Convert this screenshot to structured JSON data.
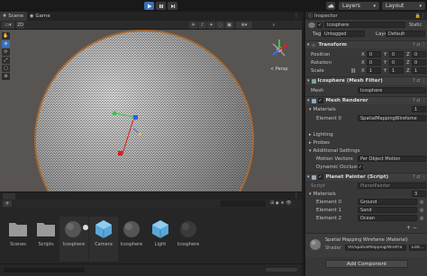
{
  "toolbar": {
    "play_icon": "play-icon",
    "pause_icon": "pause-icon",
    "step_icon": "step-icon",
    "layers_label": "Layers",
    "layout_label": "Layout"
  },
  "tabs": {
    "scene": "Scene",
    "game": "Game"
  },
  "gizmo": {
    "persp_label": "< Persp"
  },
  "project": {
    "assets": [
      {
        "label": "Scenes",
        "icon": "folder-icon"
      },
      {
        "label": "Scripts",
        "icon": "folder-icon"
      },
      {
        "label": "Icosphere",
        "icon": "sphere-icon"
      },
      {
        "label": "Camera",
        "icon": "prefab-cube-icon"
      },
      {
        "label": "Icosphere",
        "icon": "sphere-icon"
      },
      {
        "label": "Light",
        "icon": "prefab-cube-icon"
      },
      {
        "label": "Icosphere",
        "icon": "sphere-icon"
      }
    ]
  },
  "inspector": {
    "tab_label": "Inspector",
    "object_name": "Icosphere",
    "static_label": "Static",
    "tag_label": "Tag",
    "tag_value": "Untagged",
    "layer_label": "Layer",
    "layer_value": "Default",
    "transform": {
      "title": "Transform",
      "position_label": "Position",
      "rotation_label": "Rotation",
      "scale_label": "Scale",
      "position": {
        "x": "0",
        "y": "0",
        "z": "0"
      },
      "rotation": {
        "x": "0",
        "y": "0",
        "z": "0"
      },
      "scale": {
        "x": "1",
        "y": "1",
        "z": "1"
      }
    },
    "mesh_filter": {
      "title": "Icosphere (Mesh Filter)",
      "mesh_label": "Mesh",
      "mesh_value": "Icosphere"
    },
    "mesh_renderer": {
      "title": "Mesh Renderer",
      "materials_label": "Materials",
      "materials_count": "1",
      "element0_label": "Element 0",
      "element0_value": "SpatialMappingWirefame",
      "lighting_label": "Lighting",
      "probes_label": "Probes",
      "additional_label": "Additional Settings",
      "motion_label": "Motion Vectors",
      "motion_value": "Per Object Motion",
      "occlusion_label": "Dynamic Occlusion"
    },
    "planet_painter": {
      "title": "Planet Painter (Script)",
      "script_label": "Script",
      "script_value": "PlanetPainter",
      "materials_label": "Materials",
      "materials_count": "3",
      "elements": [
        {
          "label": "Element 0",
          "value": "Ground"
        },
        {
          "label": "Element 1",
          "value": "Sand"
        },
        {
          "label": "Element 2",
          "value": "Ocean"
        }
      ]
    },
    "material_preview": {
      "title": "Spatial Mapping Wirefame (Material)",
      "shader_label": "Shader",
      "shader_value": "VR/SpatialMapping/Wirefra",
      "edit_label": "Edit..."
    },
    "add_component_label": "Add Component"
  },
  "colors": {
    "accent_blue": "#3a6fbd",
    "viewport_bg": "#585451",
    "panel_bg": "#383838"
  }
}
